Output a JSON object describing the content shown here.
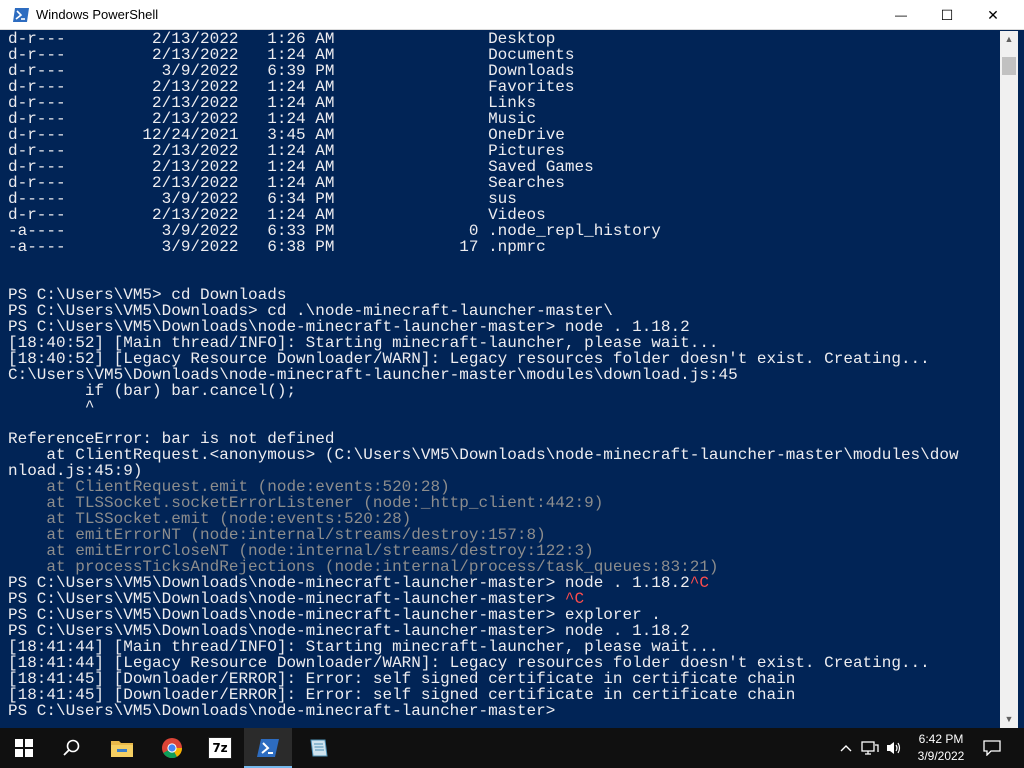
{
  "window": {
    "title": "Windows PowerShell",
    "minimize_glyph": "—",
    "maximize_glyph": "☐",
    "close_glyph": "✕"
  },
  "colors": {
    "console_bg": "#012456",
    "console_fg": "#eeedf0",
    "dim_fg": "#8d8d8d",
    "error_fg": "#ff4d4d"
  },
  "console": {
    "lines": [
      {
        "text": "d-r---         2/13/2022   1:26 AM                Desktop"
      },
      {
        "text": "d-r---         2/13/2022   1:24 AM                Documents"
      },
      {
        "text": "d-r---          3/9/2022   6:39 PM                Downloads"
      },
      {
        "text": "d-r---         2/13/2022   1:24 AM                Favorites"
      },
      {
        "text": "d-r---         2/13/2022   1:24 AM                Links"
      },
      {
        "text": "d-r---         2/13/2022   1:24 AM                Music"
      },
      {
        "text": "d-r---        12/24/2021   3:45 AM                OneDrive"
      },
      {
        "text": "d-r---         2/13/2022   1:24 AM                Pictures"
      },
      {
        "text": "d-r---         2/13/2022   1:24 AM                Saved Games"
      },
      {
        "text": "d-r---         2/13/2022   1:24 AM                Searches"
      },
      {
        "text": "d-----          3/9/2022   6:34 PM                sus"
      },
      {
        "text": "d-r---         2/13/2022   1:24 AM                Videos"
      },
      {
        "text": "-a----          3/9/2022   6:33 PM              0 .node_repl_history"
      },
      {
        "text": "-a----          3/9/2022   6:38 PM             17 .npmrc"
      },
      {
        "text": ""
      },
      {
        "text": ""
      },
      {
        "text": "PS C:\\Users\\VM5> cd Downloads"
      },
      {
        "text": "PS C:\\Users\\VM5\\Downloads> cd .\\node-minecraft-launcher-master\\"
      },
      {
        "text": "PS C:\\Users\\VM5\\Downloads\\node-minecraft-launcher-master> node . 1.18.2"
      },
      {
        "text": "[18:40:52] [Main thread/INFO]: Starting minecraft-launcher, please wait..."
      },
      {
        "text": "[18:40:52] [Legacy Resource Downloader/WARN]: Legacy resources folder doesn't exist. Creating..."
      },
      {
        "text": "C:\\Users\\VM5\\Downloads\\node-minecraft-launcher-master\\modules\\download.js:45"
      },
      {
        "text": "        if (bar) bar.cancel();"
      },
      {
        "text": "        ^"
      },
      {
        "text": ""
      },
      {
        "text": "ReferenceError: bar is not defined"
      },
      {
        "text": "    at ClientRequest.<anonymous> (C:\\Users\\VM5\\Downloads\\node-minecraft-launcher-master\\modules\\dow"
      },
      {
        "text": "nload.js:45:9)"
      },
      {
        "text": "    at ClientRequest.emit (node:events:520:28)",
        "style": "dim"
      },
      {
        "text": "    at TLSSocket.socketErrorListener (node:_http_client:442:9)",
        "style": "dim"
      },
      {
        "text": "    at TLSSocket.emit (node:events:520:28)",
        "style": "dim"
      },
      {
        "text": "    at emitErrorNT (node:internal/streams/destroy:157:8)",
        "style": "dim"
      },
      {
        "text": "    at emitErrorCloseNT (node:internal/streams/destroy:122:3)",
        "style": "dim"
      },
      {
        "text": "    at processTicksAndRejections (node:internal/process/task_queues:83:21)",
        "style": "dim"
      },
      {
        "text": "PS C:\\Users\\VM5\\Downloads\\node-minecraft-launcher-master> node . 1.18.2",
        "suffix": "^C"
      },
      {
        "text": "PS C:\\Users\\VM5\\Downloads\\node-minecraft-launcher-master> ",
        "suffix": "^C"
      },
      {
        "text": "PS C:\\Users\\VM5\\Downloads\\node-minecraft-launcher-master> explorer ."
      },
      {
        "text": "PS C:\\Users\\VM5\\Downloads\\node-minecraft-launcher-master> node . 1.18.2"
      },
      {
        "text": "[18:41:44] [Main thread/INFO]: Starting minecraft-launcher, please wait..."
      },
      {
        "text": "[18:41:44] [Legacy Resource Downloader/WARN]: Legacy resources folder doesn't exist. Creating..."
      },
      {
        "text": "[18:41:45] [Downloader/ERROR]: Error: self signed certificate in certificate chain"
      },
      {
        "text": "[18:41:45] [Downloader/ERROR]: Error: self signed certificate in certificate chain"
      },
      {
        "text": "PS C:\\Users\\VM5\\Downloads\\node-minecraft-launcher-master>"
      }
    ]
  },
  "taskbar": {
    "start_icon": "windows-logo-icon",
    "apps": [
      {
        "name": "search",
        "icon": "search-icon"
      },
      {
        "name": "file-explorer",
        "icon": "folder-icon"
      },
      {
        "name": "chrome",
        "icon": "chrome-icon"
      },
      {
        "name": "7zip",
        "icon": "7zip-icon",
        "label": "7z"
      },
      {
        "name": "powershell",
        "icon": "powershell-icon",
        "active": true
      },
      {
        "name": "notepad",
        "icon": "notepad-icon"
      }
    ],
    "tray": {
      "time": "6:42 PM",
      "date": "3/9/2022"
    }
  }
}
